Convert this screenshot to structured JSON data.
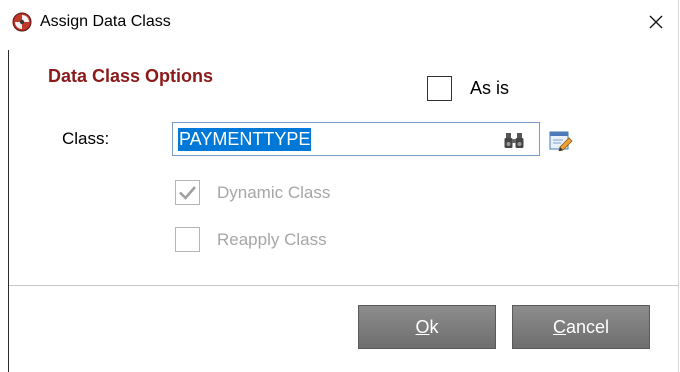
{
  "window": {
    "title": "Assign Data Class",
    "close_glyph": "✕"
  },
  "options": {
    "section_title": "Data Class Options",
    "as_is_label": "As is",
    "as_is_checked": false
  },
  "class_field": {
    "label": "Class:",
    "value": "PAYMENTTYPE",
    "search_icon": "binoculars-icon",
    "edit_icon": "edit-icon"
  },
  "checkboxes": {
    "dynamic_label": "Dynamic Class",
    "dynamic_checked": true,
    "reapply_label": "Reapply Class",
    "reapply_checked": false
  },
  "buttons": {
    "ok_mnemonic": "O",
    "ok_rest": "k",
    "cancel_mnemonic": "C",
    "cancel_rest": "ancel"
  },
  "colors": {
    "section_title": "#8b1a1a",
    "selection": "#0078d7",
    "disabled_text": "#a6a6a6",
    "button": "#7a7a7a"
  }
}
